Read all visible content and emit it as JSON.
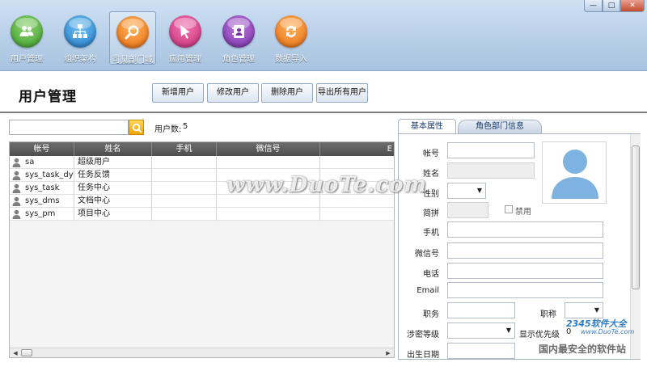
{
  "window_controls": {
    "minimize": "—",
    "maximize": "□",
    "close": "✕"
  },
  "toolbar": {
    "items": [
      {
        "label": "用户管理",
        "icon": "users-icon",
        "color": "#4caf3c"
      },
      {
        "label": "组织架构",
        "icon": "org-chart-icon",
        "color": "#2f8ed8"
      },
      {
        "label": "可见部门域",
        "icon": "search-icon",
        "color": "#f07a1a"
      },
      {
        "label": "应用管理",
        "icon": "app-icon",
        "color": "#d43f8a"
      },
      {
        "label": "角色管理",
        "icon": "contacts-icon",
        "color": "#8a3fb0"
      },
      {
        "label": "数据导入",
        "icon": "refresh-icon",
        "color": "#f07a1a"
      }
    ]
  },
  "header": {
    "title": "用户管理",
    "buttons": {
      "add": "新增用户",
      "edit": "修改用户",
      "delete": "删除用户",
      "export": "导出所有用户"
    }
  },
  "list": {
    "search_placeholder": "",
    "count_label": "用户数:",
    "count_value": "5",
    "columns": [
      "帐号",
      "姓名",
      "手机",
      "微信号",
      "E"
    ],
    "rows": [
      {
        "account": "sa",
        "name": "超级用户",
        "mobile": "",
        "wechat": ""
      },
      {
        "account": "sys_task_dyn",
        "name": "任务反馈",
        "mobile": "",
        "wechat": ""
      },
      {
        "account": "sys_task",
        "name": "任务中心",
        "mobile": "",
        "wechat": ""
      },
      {
        "account": "sys_dms",
        "name": "文档中心",
        "mobile": "",
        "wechat": ""
      },
      {
        "account": "sys_pm",
        "name": "项目中心",
        "mobile": "",
        "wechat": ""
      }
    ],
    "scroll_left": "◀",
    "scroll_right": "▶"
  },
  "panel": {
    "tabs": {
      "basic": "基本属性",
      "role": "角色部门信息"
    },
    "fields": {
      "account": "帐号",
      "name": "姓名",
      "gender": "性别",
      "pinyin": "简拼",
      "disable": "禁用",
      "mobile": "手机",
      "wechat": "微信号",
      "phone": "电话",
      "email": "Email",
      "position": "职务",
      "title": "职称",
      "secret_level": "涉密等级",
      "display_priority": "显示优先级",
      "display_priority_value": "0",
      "birthday": "出生日期"
    },
    "values": {
      "account": "",
      "gender": "",
      "secret_level": "",
      "title": ""
    }
  },
  "watermarks": {
    "duote": "www.DuoTe.com",
    "brand": "2345软件大全",
    "site": "www.DuoTe.com",
    "slogan": "国内最安全的软件站"
  },
  "colors": {
    "accent": "#2f8ed8",
    "grid_header": "#5a5a5a"
  }
}
